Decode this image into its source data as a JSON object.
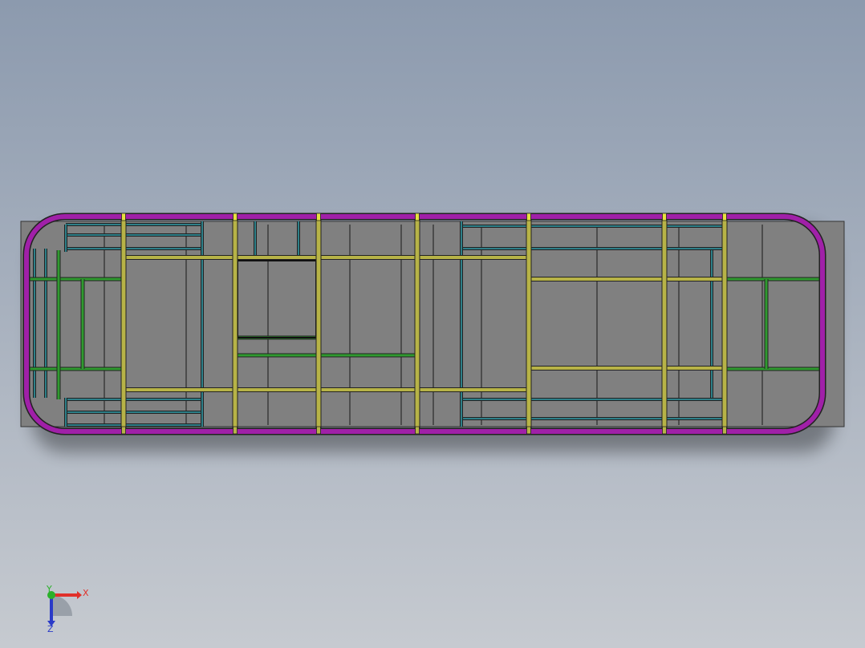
{
  "viewport": {
    "background_top": "#8c9aae",
    "background_bottom": "#c6cad0",
    "panel_color": "#808080"
  },
  "model": {
    "colors": {
      "perimeter": "#a020a8",
      "cross_member": "#b7b347",
      "green_member": "#2f9a2f",
      "teal_member": "#2d7f88",
      "dark_line": "#3a3a3a"
    }
  },
  "triad": {
    "x_label": "X",
    "y_label": "Y",
    "z_label": "Z",
    "x_color": "#e0302a",
    "y_color": "#2ab02a",
    "z_color": "#2a3ac8"
  }
}
